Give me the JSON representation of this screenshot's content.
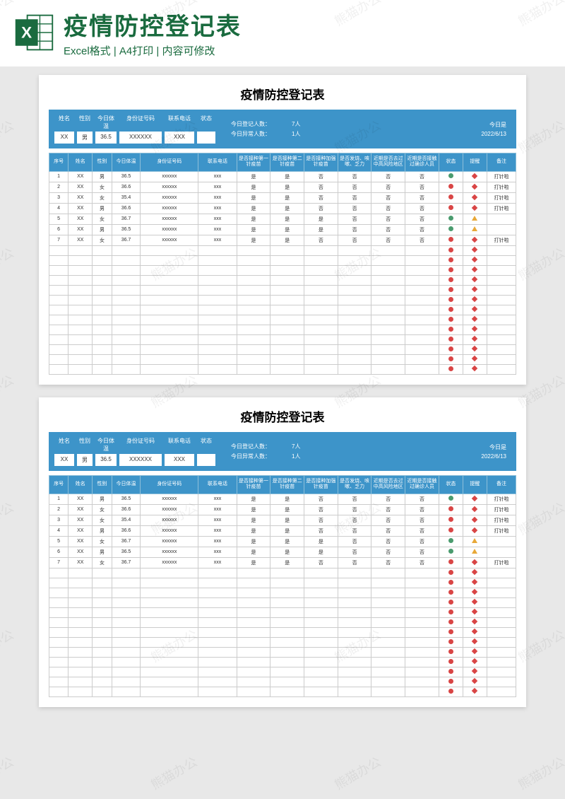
{
  "header": {
    "title": "疫情防控登记表",
    "subtitle": "Excel格式 | A4打印 | 内容可修改"
  },
  "sheet": {
    "title": "疫情防控登记表",
    "entry_labels": {
      "name": "姓名",
      "sex": "性别",
      "temp": "今日体温",
      "id": "身份证号码",
      "tel": "联系电话",
      "status": "状态"
    },
    "entry_values": {
      "name": "XX",
      "sex": "男",
      "temp": "36.5",
      "id": "XXXXXX",
      "tel": "XXX"
    },
    "stats": {
      "count_label": "今日登记人数：",
      "count_val": "7人",
      "abn_label": "今日异常人数：",
      "abn_val": "1人"
    },
    "today": {
      "label": "今日是",
      "date": "2022/6/13"
    },
    "columns": [
      "序号",
      "姓名",
      "性别",
      "今日体温",
      "身份证号码",
      "联系电话",
      "是否接种第一针疫苗",
      "是否接种第二针疫苗",
      "是否接种加强针疫苗",
      "是否发烧、咳嗽、乏力",
      "近期是否去过中高风险地区",
      "近期是否接触过确诊人员",
      "状态",
      "提醒",
      "备注"
    ],
    "rows": [
      {
        "no": "1",
        "name": "XX",
        "sex": "男",
        "temp": "36.5",
        "id": "xxxxxx",
        "tel": "xxx",
        "v1": "是",
        "v2": "是",
        "v3": "否",
        "sym": "否",
        "risk": "否",
        "contact": "否",
        "status": "green",
        "alert": "diamond",
        "note": "打针啦"
      },
      {
        "no": "2",
        "name": "XX",
        "sex": "女",
        "temp": "36.6",
        "id": "xxxxxx",
        "tel": "xxx",
        "v1": "是",
        "v2": "是",
        "v3": "否",
        "sym": "否",
        "risk": "否",
        "contact": "否",
        "status": "red",
        "alert": "diamond",
        "note": "打针啦"
      },
      {
        "no": "3",
        "name": "XX",
        "sex": "女",
        "temp": "35.4",
        "id": "xxxxxx",
        "tel": "xxx",
        "v1": "是",
        "v2": "是",
        "v3": "否",
        "sym": "否",
        "risk": "否",
        "contact": "否",
        "status": "red",
        "alert": "diamond",
        "note": "打针啦"
      },
      {
        "no": "4",
        "name": "XX",
        "sex": "男",
        "temp": "36.6",
        "id": "xxxxxx",
        "tel": "xxx",
        "v1": "是",
        "v2": "是",
        "v3": "否",
        "sym": "否",
        "risk": "否",
        "contact": "否",
        "status": "red",
        "alert": "diamond",
        "note": "打针啦"
      },
      {
        "no": "5",
        "name": "XX",
        "sex": "女",
        "temp": "36.7",
        "id": "xxxxxx",
        "tel": "xxx",
        "v1": "是",
        "v2": "是",
        "v3": "是",
        "sym": "否",
        "risk": "否",
        "contact": "否",
        "status": "green",
        "alert": "tri",
        "note": ""
      },
      {
        "no": "6",
        "name": "XX",
        "sex": "男",
        "temp": "36.5",
        "id": "xxxxxx",
        "tel": "xxx",
        "v1": "是",
        "v2": "是",
        "v3": "是",
        "sym": "否",
        "risk": "否",
        "contact": "否",
        "status": "green",
        "alert": "tri",
        "note": ""
      },
      {
        "no": "7",
        "name": "XX",
        "sex": "女",
        "temp": "36.7",
        "id": "xxxxxx",
        "tel": "xxx",
        "v1": "是",
        "v2": "是",
        "v3": "否",
        "sym": "否",
        "risk": "否",
        "contact": "否",
        "status": "red",
        "alert": "diamond",
        "note": "打针啦"
      }
    ],
    "empty_rows": 13
  },
  "watermark": "熊猫办公"
}
